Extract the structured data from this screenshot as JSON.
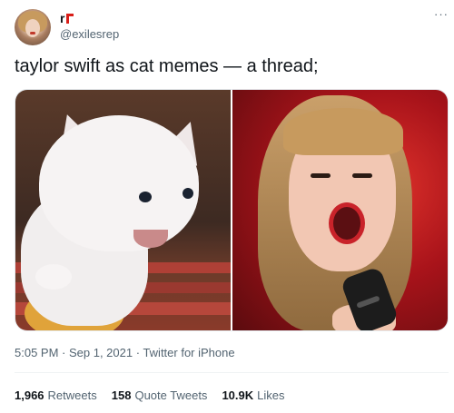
{
  "author": {
    "display_name": "r",
    "handle": "@exilesrep"
  },
  "more_label": "···",
  "tweet": {
    "text": "taylor swift as cat memes — a thread;"
  },
  "meta": {
    "time": "5:05 PM",
    "sep1": " · ",
    "date": "Sep 1, 2021",
    "sep2": " · ",
    "source": "Twitter for iPhone"
  },
  "stats": {
    "retweets": {
      "count": "1,966",
      "label": "Retweets"
    },
    "quotes": {
      "count": "158",
      "label": "Quote Tweets"
    },
    "likes": {
      "count": "10.9K",
      "label": "Likes"
    }
  },
  "icons": {
    "verified_flag": "red-flag-icon",
    "more": "more-dots-icon"
  }
}
